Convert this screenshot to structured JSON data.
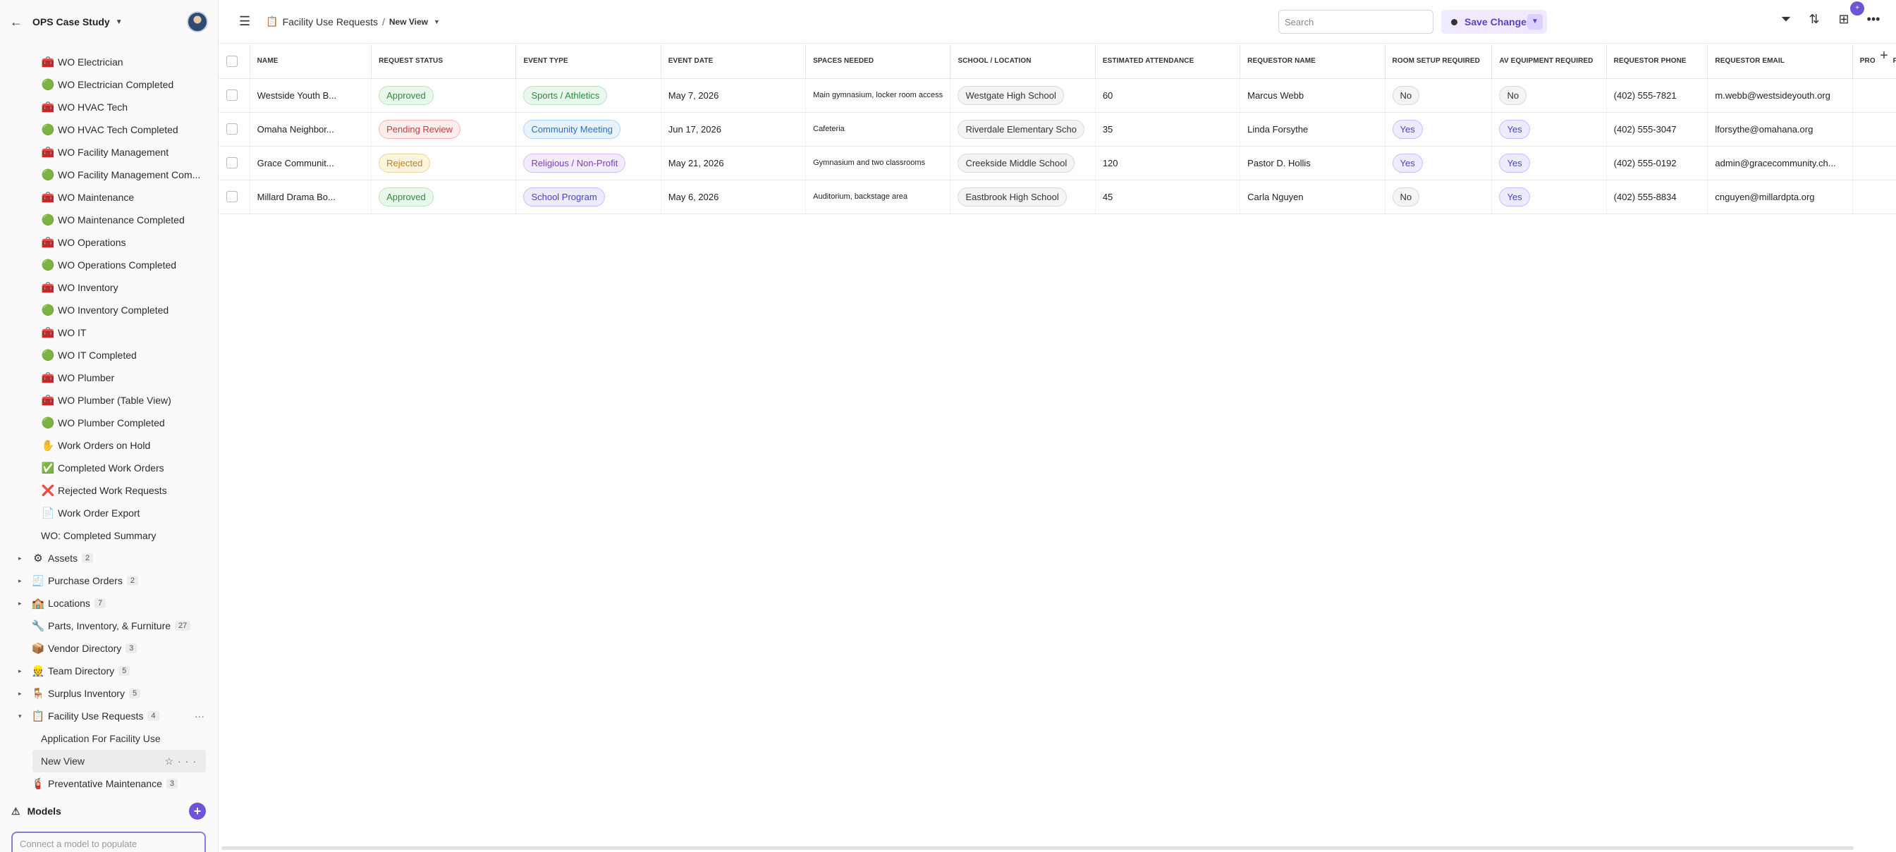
{
  "sidebar": {
    "workspace": "OPS Case Study",
    "sub_items": [
      {
        "icon": "🧰",
        "label": "WO Electrician"
      },
      {
        "icon": "🟢",
        "label": "WO Electrician Completed"
      },
      {
        "icon": "🧰",
        "label": "WO HVAC Tech"
      },
      {
        "icon": "🟢",
        "label": "WO HVAC Tech Completed"
      },
      {
        "icon": "🧰",
        "label": "WO Facility Management"
      },
      {
        "icon": "🟢",
        "label": "WO Facility Management Com..."
      },
      {
        "icon": "🧰",
        "label": "WO Maintenance"
      },
      {
        "icon": "🟢",
        "label": "WO Maintenance Completed"
      },
      {
        "icon": "🧰",
        "label": "WO Operations"
      },
      {
        "icon": "🟢",
        "label": "WO Operations Completed"
      },
      {
        "icon": "🧰",
        "label": "WO Inventory"
      },
      {
        "icon": "🟢",
        "label": "WO Inventory Completed"
      },
      {
        "icon": "🧰",
        "label": "WO IT"
      },
      {
        "icon": "🟢",
        "label": "WO IT Completed"
      },
      {
        "icon": "🧰",
        "label": "WO Plumber"
      },
      {
        "icon": "🧰",
        "label": "WO Plumber (Table View)"
      },
      {
        "icon": "🟢",
        "label": "WO Plumber Completed"
      },
      {
        "icon": "✋",
        "label": "Work Orders on Hold"
      },
      {
        "icon": "✅",
        "label": "Completed Work Orders"
      },
      {
        "icon": "❌",
        "label": "Rejected Work Requests"
      },
      {
        "icon": "📄",
        "label": "Work Order Export"
      },
      {
        "icon": "",
        "label": "WO: Completed Summary"
      }
    ],
    "top_items": [
      {
        "icon": "⚙",
        "label": "Assets",
        "count": "2",
        "caret": "▸"
      },
      {
        "icon": "🧾",
        "label": "Purchase Orders",
        "count": "2",
        "caret": "▸"
      },
      {
        "icon": "🏫",
        "label": "Locations",
        "count": "7",
        "caret": "▸"
      },
      {
        "icon": "🔧",
        "label": "Parts, Inventory, & Furniture",
        "count": "27",
        "caret": ""
      },
      {
        "icon": "📦",
        "label": "Vendor Directory",
        "count": "3",
        "caret": ""
      },
      {
        "icon": "👷",
        "label": "Team Directory",
        "count": "5",
        "caret": "▸"
      },
      {
        "icon": "🪑",
        "label": "Surplus Inventory",
        "count": "5",
        "caret": "▸"
      },
      {
        "icon": "📋",
        "label": "Facility Use Requests",
        "count": "4",
        "caret": "▾"
      }
    ],
    "views": [
      {
        "label": "Application For Facility Use"
      },
      {
        "label": "New View"
      }
    ],
    "after_views": {
      "icon": "🧯",
      "label": "Preventative Maintenance",
      "count": "3"
    },
    "models_label": "Models",
    "model_input_placeholder": "Connect a model to populate"
  },
  "topbar": {
    "breadcrumb_icon": "📋",
    "breadcrumb_table": "Facility Use Requests",
    "breadcrumb_sep": "/",
    "view_name": "New View",
    "search_placeholder": "Search",
    "save_label": "Save Changes",
    "notification_count": "+"
  },
  "table": {
    "columns": [
      "NAME",
      "REQUEST STATUS",
      "EVENT TYPE",
      "EVENT DATE",
      "SPACES NEEDED",
      "SCHOOL / LOCATION",
      "ESTIMATED ATTENDANCE",
      "REQUESTOR NAME",
      "ROOM SETUP REQUIRED",
      "AV EQUIPMENT REQUIRED",
      "REQUESTOR PHONE",
      "REQUESTOR EMAIL",
      "PROOF OF INSURA"
    ],
    "rows": [
      {
        "name": "Westside Youth B...",
        "status": "Approved",
        "event_type": "Sports / Athletics",
        "event_date": "May 7, 2026",
        "spaces": "Main gymnasium, locker room access",
        "location": "Westgate High School",
        "attendance": "60",
        "requestor": "Marcus Webb",
        "room_setup": "No",
        "av": "No",
        "phone": "(402) 555-7821",
        "email": "m.webb@westsideyouth.org"
      },
      {
        "name": "Omaha Neighbor...",
        "status": "Pending Review",
        "event_type": "Community Meeting",
        "event_date": "Jun 17, 2026",
        "spaces": "Cafeteria",
        "location": "Riverdale Elementary Scho",
        "attendance": "35",
        "requestor": "Linda Forsythe",
        "room_setup": "Yes",
        "av": "Yes",
        "phone": "(402) 555-3047",
        "email": "lforsythe@omahana.org"
      },
      {
        "name": "Grace Communit...",
        "status": "Rejected",
        "event_type": "Religious / Non-Profit",
        "event_date": "May 21, 2026",
        "spaces": "Gymnasium and two classrooms",
        "location": "Creekside Middle School",
        "attendance": "120",
        "requestor": "Pastor D. Hollis",
        "room_setup": "Yes",
        "av": "Yes",
        "phone": "(402) 555-0192",
        "email": "admin@gracecommunity.ch..."
      },
      {
        "name": "Millard Drama Bo...",
        "status": "Approved",
        "event_type": "School Program",
        "event_date": "May 6, 2026",
        "spaces": "Auditorium, backstage area",
        "location": "Eastbrook High School",
        "attendance": "45",
        "requestor": "Carla Nguyen",
        "room_setup": "No",
        "av": "Yes",
        "phone": "(402) 555-8834",
        "email": "cnguyen@millardpta.org"
      }
    ]
  }
}
